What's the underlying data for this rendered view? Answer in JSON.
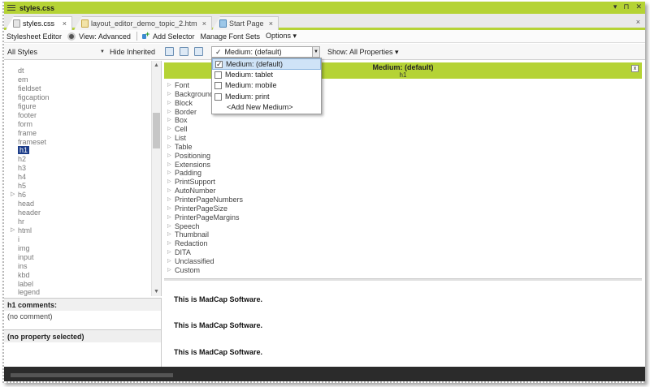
{
  "window": {
    "title": "styles.css",
    "controls": [
      "▾",
      "⊓",
      "✕"
    ]
  },
  "tabs": [
    {
      "label": "styles.css",
      "icon": "css-file-icon",
      "active": true
    },
    {
      "label": "layout_editor_demo_topic_2.htm",
      "icon": "htm-file-icon",
      "active": false
    },
    {
      "label": "Start Page",
      "icon": "start-page-icon",
      "active": false
    }
  ],
  "tab_close": "×",
  "tabstrip_close": "×",
  "toolbar1": {
    "stylesheet_editor": "Stylesheet Editor",
    "view_advanced": "View: Advanced",
    "add_selector": "Add Selector",
    "manage_font_sets": "Manage Font Sets",
    "options": "Options ▾"
  },
  "toolbar2": {
    "styles_filter": "All Styles",
    "hide_inherited": "Hide Inherited",
    "medium": "Medium: (default)",
    "show_properties": "Show: All Properties ▾"
  },
  "medium_dropdown": {
    "items": [
      {
        "label": "Medium: (default)",
        "checked": true,
        "selected": true
      },
      {
        "label": "Medium: tablet",
        "checked": false,
        "selected": false
      },
      {
        "label": "Medium: mobile",
        "checked": false,
        "selected": false
      },
      {
        "label": "Medium: print",
        "checked": false,
        "selected": false
      }
    ],
    "add_new": "<Add New Medium>"
  },
  "styles_list": [
    {
      "label": "dt",
      "expandable": false
    },
    {
      "label": "em",
      "expandable": false
    },
    {
      "label": "fieldset",
      "expandable": false
    },
    {
      "label": "figcaption",
      "expandable": false
    },
    {
      "label": "figure",
      "expandable": false
    },
    {
      "label": "footer",
      "expandable": false
    },
    {
      "label": "form",
      "expandable": false
    },
    {
      "label": "frame",
      "expandable": false
    },
    {
      "label": "frameset",
      "expandable": false
    },
    {
      "label": "h1",
      "expandable": false,
      "selected": true
    },
    {
      "label": "h2",
      "expandable": false
    },
    {
      "label": "h3",
      "expandable": false
    },
    {
      "label": "h4",
      "expandable": false
    },
    {
      "label": "h5",
      "expandable": false
    },
    {
      "label": "h6",
      "expandable": true
    },
    {
      "label": "head",
      "expandable": false
    },
    {
      "label": "header",
      "expandable": false
    },
    {
      "label": "hr",
      "expandable": false
    },
    {
      "label": "html",
      "expandable": true
    },
    {
      "label": "i",
      "expandable": false
    },
    {
      "label": "img",
      "expandable": false
    },
    {
      "label": "input",
      "expandable": false
    },
    {
      "label": "ins",
      "expandable": false
    },
    {
      "label": "kbd",
      "expandable": false
    },
    {
      "label": "label",
      "expandable": false
    },
    {
      "label": "legend",
      "expandable": false
    }
  ],
  "comments": {
    "header": "h1 comments:",
    "body": "(no comment)"
  },
  "property_selected": "(no property selected)",
  "properties_header": {
    "title": "Medium: (default)",
    "subtitle": "h1",
    "close": "x"
  },
  "property_groups": [
    "Font",
    "Background",
    "Block",
    "Border",
    "Box",
    "Cell",
    "List",
    "Table",
    "Positioning",
    "Extensions",
    "Padding",
    "PrintSupport",
    "AutoNumber",
    "PrinterPageNumbers",
    "PrinterPageSize",
    "PrinterPageMargins",
    "Speech",
    "Thumbnail",
    "Redaction",
    "DITA",
    "Unclassified",
    "Custom"
  ],
  "preview_lines": [
    "This is MadCap Software.",
    "This is MadCap Software.",
    "This is MadCap Software."
  ],
  "colors": {
    "accent": "#b5d335",
    "selection": "#1e3e8a",
    "dropdown_highlight": "#cfe3f7"
  }
}
